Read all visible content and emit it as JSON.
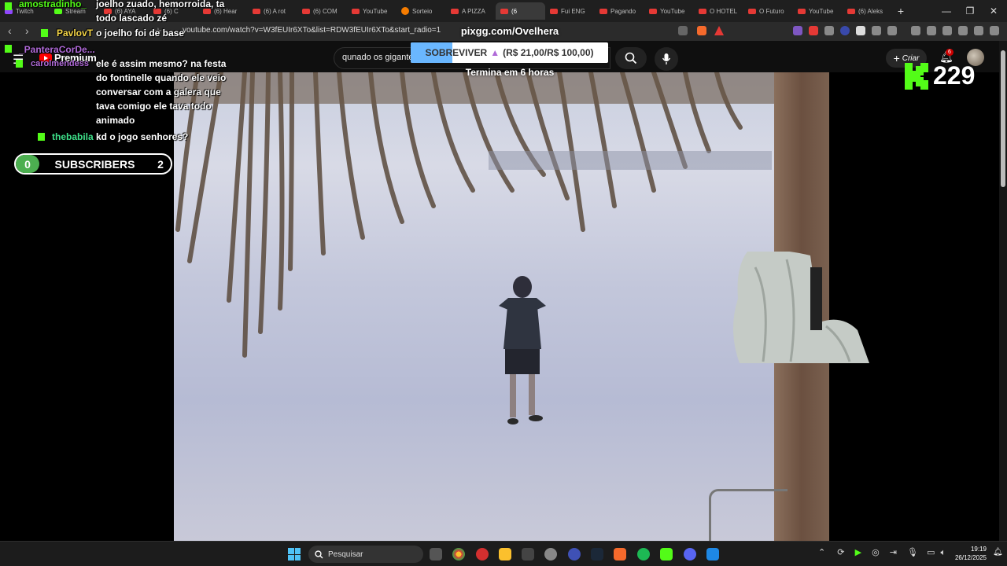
{
  "browser": {
    "tabs": [
      {
        "label": "Twitch",
        "favicon": "twitch"
      },
      {
        "label": "Stream",
        "favicon": "kick"
      },
      {
        "label": "(6) AYA",
        "favicon": "red"
      },
      {
        "label": "(6) C",
        "favicon": "red"
      },
      {
        "label": "(6) Hear",
        "favicon": "red"
      },
      {
        "label": "(6) A rot",
        "favicon": "red"
      },
      {
        "label": "(6) COM",
        "favicon": "red"
      },
      {
        "label": "YouTube",
        "favicon": "red"
      },
      {
        "label": "Sorteio",
        "favicon": "orange"
      },
      {
        "label": "A PIZZA",
        "favicon": "red"
      },
      {
        "label": "(6",
        "favicon": "red",
        "active": true
      },
      {
        "label": "Fui ENG",
        "favicon": "red"
      },
      {
        "label": "Pagando",
        "favicon": "red"
      },
      {
        "label": "YouTube",
        "favicon": "red"
      },
      {
        "label": "O HOTEL",
        "favicon": "red"
      },
      {
        "label": "O Futuro",
        "favicon": "red"
      },
      {
        "label": "YouTube",
        "favicon": "red"
      },
      {
        "label": "(6) Aleks",
        "favicon": "red"
      }
    ],
    "new_tab": "+",
    "window_controls": {
      "minimize": "—",
      "restore": "❐",
      "close": "✕"
    },
    "url": "youtube.com/watch?v=W3fEUIr6XTo&list=RDW3fEUIr6XTo&start_radio=1"
  },
  "youtube": {
    "logo_text": "Premium",
    "search_value": "qunado os gigante",
    "create_label": "Criar",
    "notification_count": "6"
  },
  "overlay": {
    "goal_title": "pixgg.com/Ovelhera",
    "goal_label": "SOBREVIVER",
    "goal_amount": "(R$ 21,00/R$ 100,00)",
    "goal_progress": 0.21,
    "goal_subtitle": "Termina em 6 horas",
    "viewer_count": "229",
    "subs_start": "0",
    "subs_label": "SUBSCRIBERS",
    "subs_goal": "2"
  },
  "chat": [
    {
      "user": "amostradinho_",
      "user_color": "#53fc18",
      "text": "joelho zuado, hemorroida, ta todo lascado zé"
    },
    {
      "user": "PavlovT",
      "user_color": "#f5d547",
      "text": "o joelho foi de base"
    },
    {
      "user": "_PanteraCorDe...",
      "user_color": "#b06ad8",
      "text": ""
    },
    {
      "user": "carolmendess",
      "user_color": "#b06ad8",
      "text": "ele é assim mesmo? na festa do fontinelle quando ele veio conversar com a galera que tava comigo ele tava todo animado"
    },
    {
      "user": "thebabila",
      "user_color": "#3ee08a",
      "text": "kd o jogo senhores?"
    }
  ],
  "taskbar": {
    "search_placeholder": "Pesquisar",
    "time": "19:19",
    "date": "26/12/2025"
  }
}
